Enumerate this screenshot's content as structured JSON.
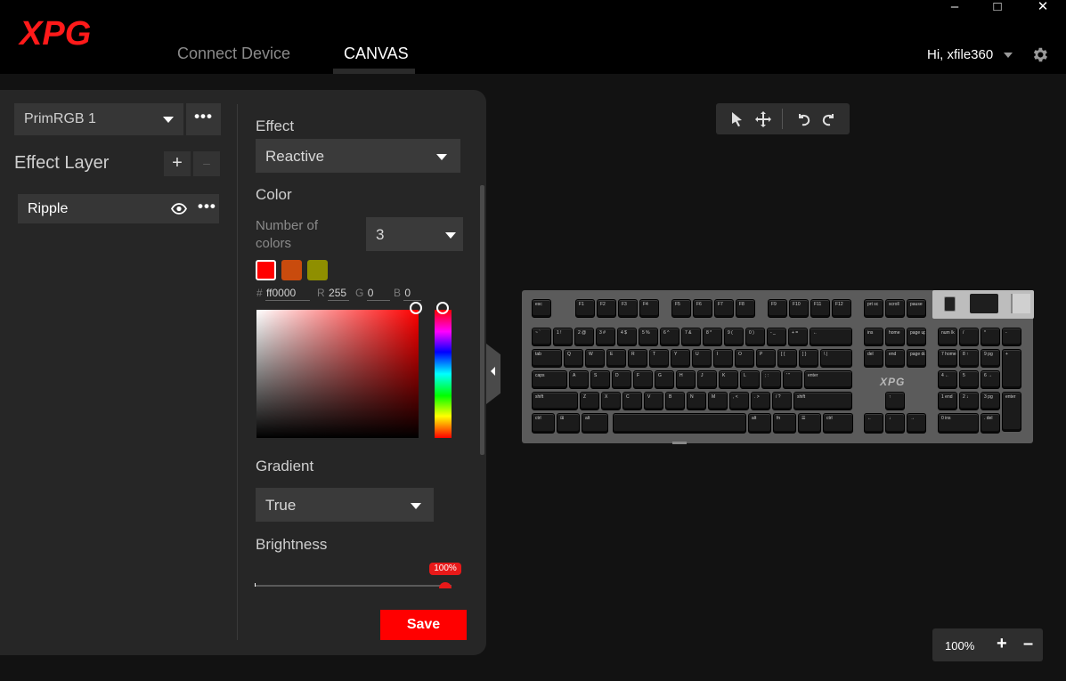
{
  "window": {
    "logo_text": "XPG",
    "minimize_glyph": "–",
    "maximize_glyph": "□",
    "close_glyph": "✕"
  },
  "nav": {
    "tabs": [
      {
        "label": "Connect Device",
        "active": false
      },
      {
        "label": "CANVAS",
        "active": true
      }
    ],
    "user_greeting": "Hi, xfile360"
  },
  "left_panel": {
    "profile": {
      "selected": "PrimRGB 1",
      "more": "•••"
    },
    "effect_layer": {
      "title": "Effect Layer",
      "add": "+",
      "remove": "–",
      "layers": [
        {
          "name": "Ripple",
          "more": "•••"
        }
      ]
    },
    "effect": {
      "label": "Effect",
      "selected": "Reactive"
    },
    "color": {
      "label": "Color",
      "number_label": "Number of colors",
      "number_value": "3",
      "swatches": [
        "#ff0000",
        "#c94b0d",
        "#8f8f00"
      ],
      "hex_prefix": "#",
      "hex": "ff0000",
      "r_label": "R",
      "r": "255",
      "g_label": "G",
      "g": "0",
      "b_label": "B",
      "b": "0"
    },
    "gradient": {
      "label": "Gradient",
      "selected": "True"
    },
    "brightness": {
      "label": "Brightness",
      "value_text": "100%",
      "value": 1.0
    },
    "save_label": "Save"
  },
  "canvas": {
    "zoom": "100%",
    "zoom_in": "+",
    "zoom_out": "–",
    "keyboard_brand": "XPG",
    "keys": {
      "fn_row": [
        "esc",
        "F1",
        "F2",
        "F3",
        "F4",
        "F5",
        "F6",
        "F7",
        "F8",
        "F9",
        "F10",
        "F11",
        "F12",
        "prt sc",
        "scroll",
        "pause"
      ],
      "num_row": [
        "~ `",
        "1 !",
        "2 @",
        "3 #",
        "4 $",
        "5 %",
        "6 ^",
        "7 &",
        "8 *",
        "9 (",
        "0 )",
        "- _",
        "+ =",
        "←",
        "ins",
        "home",
        "page up",
        "num lk",
        "/",
        "*",
        "-"
      ],
      "tab_row": [
        "tab",
        "Q",
        "W",
        "E",
        "R",
        "T",
        "Y",
        "U",
        "I",
        "O",
        "P",
        "[ {",
        "] }",
        "\\ |",
        "del",
        "end",
        "page down",
        "7 home",
        "8 ↑",
        "9 pg",
        "+"
      ],
      "caps_row": [
        "caps",
        "A",
        "S",
        "D",
        "F",
        "G",
        "H",
        "J",
        "K",
        "L",
        "; :",
        "' \"",
        "enter",
        "4 ←",
        "5",
        "6 →"
      ],
      "shift_row": [
        "shift",
        "Z",
        "X",
        "C",
        "V",
        "B",
        "N",
        "M",
        ", <",
        ". >",
        "/ ?",
        "shift",
        "↑",
        "1 end",
        "2 ↓",
        "3 pg",
        "enter"
      ],
      "ctrl_row": [
        "ctrl",
        "⊞",
        "alt",
        "",
        "alt",
        "fn",
        "☰",
        "ctrl",
        "←",
        "↓",
        "→",
        "0 ins",
        ". del"
      ]
    }
  },
  "colors": {
    "accent": "#ff0000",
    "panel": "#262626",
    "background": "#121212"
  }
}
